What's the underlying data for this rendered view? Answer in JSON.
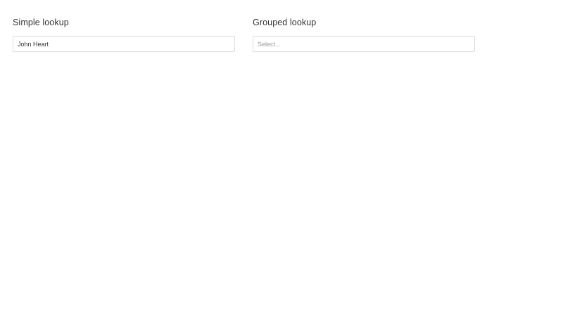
{
  "simple_lookup": {
    "title": "Simple lookup",
    "value": "John Heart"
  },
  "grouped_lookup": {
    "title": "Grouped lookup",
    "placeholder": "Select..."
  }
}
